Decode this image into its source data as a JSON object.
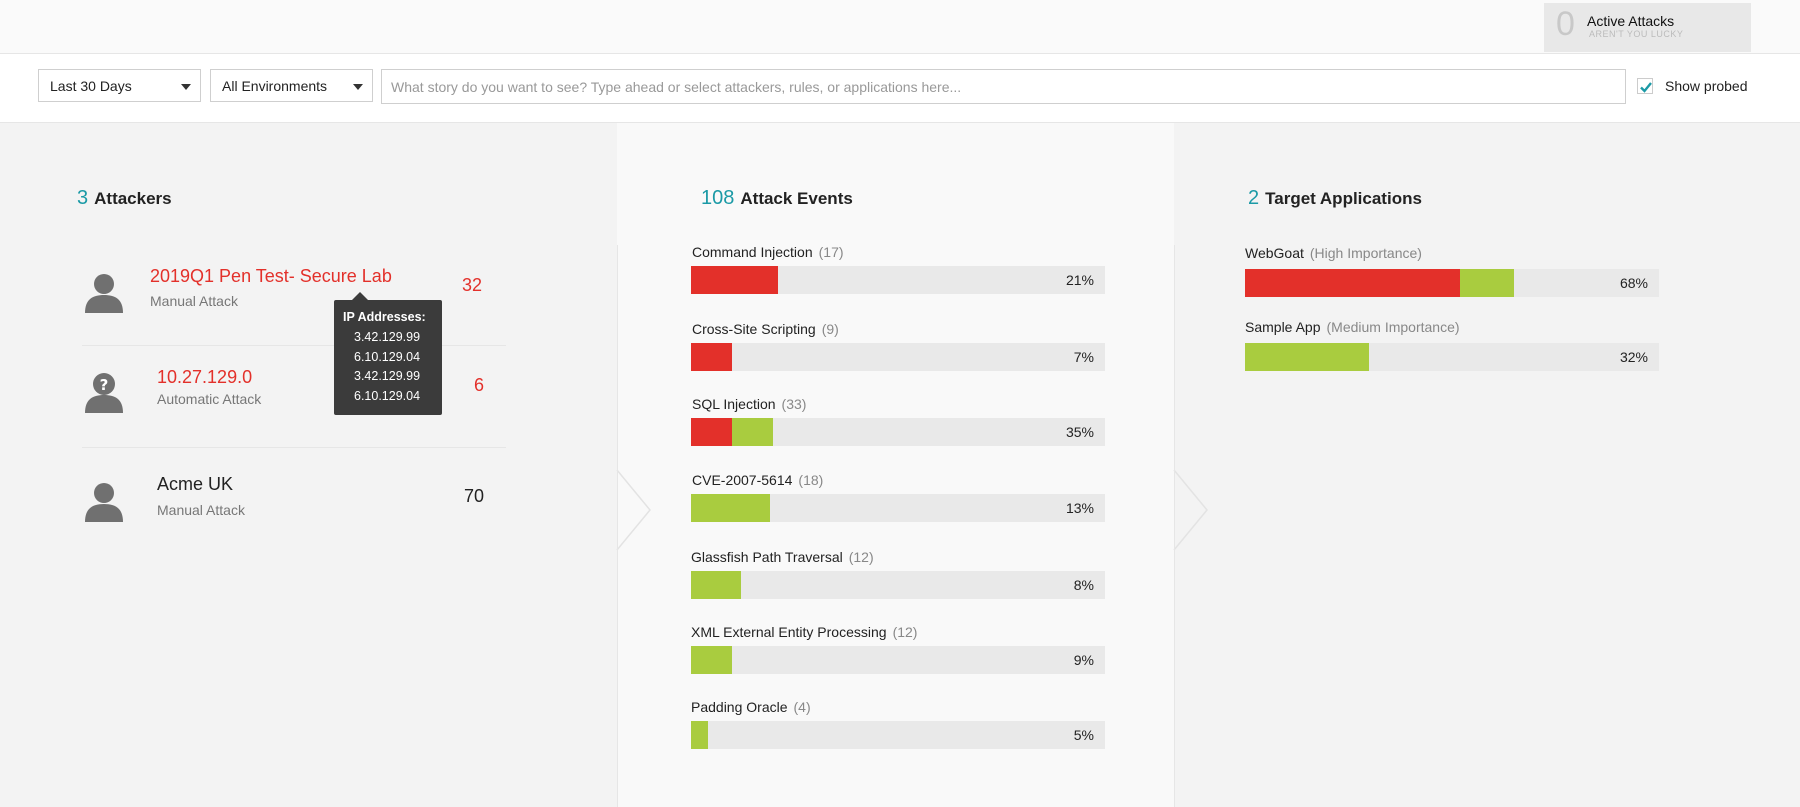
{
  "active_attacks": {
    "count": "0",
    "label": "Active Attacks",
    "sub": "AREN'T YOU LUCKY"
  },
  "filters": {
    "period": "Last 30 Days",
    "environment": "All Environments",
    "search_placeholder": "What story do you want to see? Type ahead or select attackers, rules, or applications here...",
    "show_probed_label": "Show probed",
    "show_probed_checked": true
  },
  "colors": {
    "accent": "#1b9aa6",
    "red": "#e3302a",
    "green": "#a9cc3f"
  },
  "attackers": {
    "count": "3",
    "title": "Attackers",
    "items": [
      {
        "name": "2019Q1 Pen Test- Secure Lab",
        "type": "Manual Attack",
        "count": "32",
        "icon": "person-icon",
        "highlight": true
      },
      {
        "name": "10.27.129.0",
        "type": "Automatic Attack",
        "count": "6",
        "icon": "unknown-person-icon",
        "highlight": true
      },
      {
        "name": "Acme UK",
        "type": "Manual Attack",
        "count": "70",
        "icon": "person-icon",
        "highlight": false
      }
    ],
    "tooltip": {
      "title": "IP Addresses:",
      "ips": [
        "3.42.129.99",
        "6.10.129.04",
        "3.42.129.99",
        "6.10.129.04"
      ]
    }
  },
  "events": {
    "count": "108",
    "title": "Attack Events",
    "items": [
      {
        "name": "Command Injection",
        "count": "(17)",
        "pct": "21%",
        "red": 0.21,
        "green": 0
      },
      {
        "name": "Cross-Site Scripting",
        "count": "(9)",
        "pct": "7%",
        "red": 0.1,
        "green": 0
      },
      {
        "name": "SQL Injection",
        "count": "(33)",
        "pct": "35%",
        "red": 0.1,
        "green": 0.1
      },
      {
        "name": "CVE-2007-5614",
        "count": "(18)",
        "pct": "13%",
        "red": 0,
        "green": 0.19
      },
      {
        "name": "Glassfish Path Traversal",
        "count": "(12)",
        "pct": "8%",
        "red": 0,
        "green": 0.12
      },
      {
        "name": "XML External Entity Processing",
        "count": "(12)",
        "pct": "9%",
        "red": 0,
        "green": 0.1
      },
      {
        "name": "Padding Oracle",
        "count": "(4)",
        "pct": "5%",
        "red": 0,
        "green": 0.04
      }
    ]
  },
  "apps": {
    "count": "2",
    "title": "Target Applications",
    "items": [
      {
        "name": "WebGoat",
        "importance": "(High Importance)",
        "pct": "68%",
        "red": 0.52,
        "green": 0.13
      },
      {
        "name": "Sample App",
        "importance": "(Medium Importance)",
        "pct": "32%",
        "red": 0,
        "green": 0.3
      }
    ]
  }
}
